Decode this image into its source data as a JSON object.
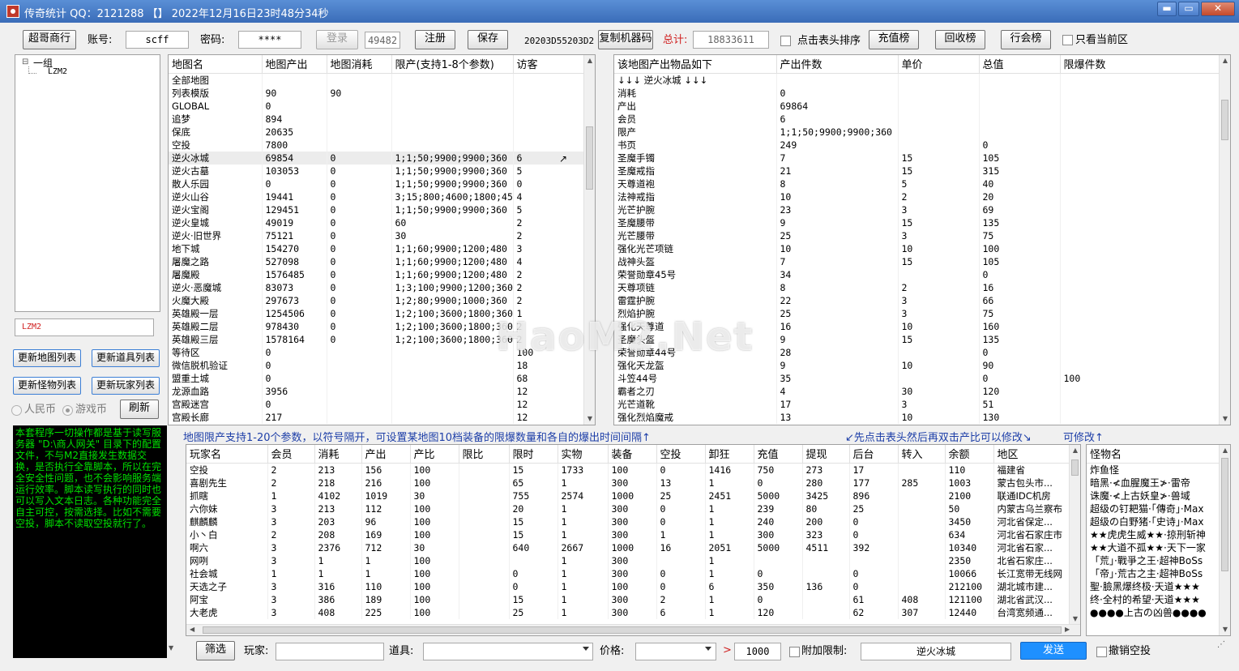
{
  "window": {
    "title": "传奇统计 QQ：2121288 【】 2022年12月16日23时48分34秒",
    "min": "▬",
    "max": "▭",
    "close": "✕"
  },
  "toolbar": {
    "shop_btn": "超哥商行",
    "account_label": "账号:",
    "account_value": "scff",
    "password_label": "密码:",
    "password_value": "****",
    "login_btn": "登录",
    "login_code": "49482",
    "register_btn": "注册",
    "save_btn": "保存",
    "machine_code": "20203D55203D2",
    "copy_machine_btn": "复制机器码",
    "total_label": "总计:",
    "total_value": "18833611",
    "sort_label": "点击表头排序",
    "recharge_btn": "充值榜",
    "recycle_btn": "回收榜",
    "guild_btn": "行会榜",
    "current_area_label": "只看当前区"
  },
  "tree": {
    "group": "一组",
    "child": "LZM2",
    "expander": "⊟"
  },
  "left_controls": {
    "selected_value": "LZM2",
    "update_map_btn": "更新地图列表",
    "update_item_btn": "更新道具列表",
    "update_monster_btn": "更新怪物列表",
    "update_player_btn": "更新玩家列表",
    "radio_rmb": "人民币",
    "radio_game": "游戏币",
    "refresh_btn": "刷新",
    "console_text": "本套程序一切操作都是基于读写服务器 \"D:\\商人网关\" 目录下的配置文件，不与M2直接发生数据交换，是否执行全靠脚本，所以在完全安全性问题，也不会影响服务端运行效率。脚本读写执行的同时也可以写入文本日志。各种功能完全自主可控，按需选择。比如不需要空投，脚本不读取空投就行了。"
  },
  "map_table": {
    "headers": [
      "地图名",
      "地图产出",
      "地图消耗",
      "限产(支持1-8个参数)",
      "访客"
    ],
    "rows": [
      [
        "全部地图",
        "",
        "",
        "",
        ""
      ],
      [
        "列表模版",
        "90",
        "90",
        "",
        ""
      ],
      [
        "GLOBAL",
        "0",
        "",
        "",
        ""
      ],
      [
        "追梦",
        "894",
        "",
        "",
        ""
      ],
      [
        "保底",
        "20635",
        "",
        "",
        ""
      ],
      [
        "空投",
        "7800",
        "",
        "",
        ""
      ],
      [
        "逆火冰城",
        "69854",
        "0",
        "1;1;50;9900;9900;360",
        "6"
      ],
      [
        "逆火古墓",
        "103053",
        "0",
        "1;1;50;9900;9900;360",
        "5"
      ],
      [
        "散人乐园",
        "0",
        "0",
        "1;1;50;9900;9900;360",
        "0"
      ],
      [
        "逆火山谷",
        "19441",
        "0",
        "3;15;800;4600;1800;45",
        "4"
      ],
      [
        "逆火宝阁",
        "129451",
        "0",
        "1;1;50;9900;9900;360",
        "5"
      ],
      [
        "逆火皇城",
        "49019",
        "0",
        "60",
        "2"
      ],
      [
        "逆火·旧世界",
        "75121",
        "0",
        "30",
        "2"
      ],
      [
        "地下城",
        "154270",
        "0",
        "1;1;60;9900;1200;480",
        "3"
      ],
      [
        "屠魔之路",
        "527098",
        "0",
        "1;1;60;9900;1200;480",
        "4"
      ],
      [
        "屠魔殿",
        "1576485",
        "0",
        "1;1;60;9900;1200;480",
        "2"
      ],
      [
        "逆火·恶魔城",
        "83073",
        "0",
        "1;3;100;9900;1200;360",
        "2"
      ],
      [
        "火魔大殿",
        "297673",
        "0",
        "1;2;80;9900;1000;360",
        "2"
      ],
      [
        "英雄殿一层",
        "1254506",
        "0",
        "1;2;100;3600;1800;360",
        "1"
      ],
      [
        "英雄殿二层",
        "978430",
        "0",
        "1;2;100;3600;1800;360",
        "2"
      ],
      [
        "英雄殿三层",
        "1578164",
        "0",
        "1;2;100;3600;1800;360",
        "2"
      ],
      [
        "等待区",
        "0",
        "",
        "",
        "100"
      ],
      [
        "微信脱机验证",
        "0",
        "",
        "",
        "18"
      ],
      [
        "盟重土城",
        "0",
        "",
        "",
        "68"
      ],
      [
        "龙源血路",
        "3956",
        "",
        "",
        "12"
      ],
      [
        "宫殿迷宫",
        "0",
        "",
        "",
        "12"
      ],
      [
        "宫殿长廊",
        "217",
        "",
        "",
        "12"
      ]
    ],
    "cursor": "↗"
  },
  "item_table": {
    "headers": [
      "该地图产出物品如下",
      "产出件数",
      "单价",
      "总值",
      "限爆件数"
    ],
    "rows": [
      [
        "↓↓↓ 逆火冰城 ↓↓↓",
        "",
        "",
        "",
        ""
      ],
      [
        "消耗",
        "0",
        "",
        "",
        ""
      ],
      [
        "产出",
        "69864",
        "",
        "",
        ""
      ],
      [
        "会员",
        "6",
        "",
        "",
        ""
      ],
      [
        "限产",
        "1;1;50;9900;9900;360",
        "",
        "",
        ""
      ],
      [
        "书页",
        "249",
        "",
        "0",
        ""
      ],
      [
        "圣魔手镯",
        "7",
        "15",
        "105",
        ""
      ],
      [
        "圣魔戒指",
        "21",
        "15",
        "315",
        ""
      ],
      [
        "天尊道袍",
        "8",
        "5",
        "40",
        ""
      ],
      [
        "法神戒指",
        "10",
        "2",
        "20",
        ""
      ],
      [
        "光芒护腕",
        "23",
        "3",
        "69",
        ""
      ],
      [
        "圣魔腰带",
        "9",
        "15",
        "135",
        ""
      ],
      [
        "光芒腰带",
        "25",
        "3",
        "75",
        ""
      ],
      [
        "强化光芒项链",
        "10",
        "10",
        "100",
        ""
      ],
      [
        "战神头盔",
        "7",
        "15",
        "105",
        ""
      ],
      [
        "荣誉勋章45号",
        "34",
        "",
        "0",
        ""
      ],
      [
        "天尊项链",
        "8",
        "2",
        "16",
        ""
      ],
      [
        "雷霆护腕",
        "22",
        "3",
        "66",
        ""
      ],
      [
        "烈焰护腕",
        "25",
        "3",
        "75",
        ""
      ],
      [
        "强化天尊道",
        "16",
        "10",
        "160",
        ""
      ],
      [
        "圣魔头盔",
        "9",
        "15",
        "135",
        ""
      ],
      [
        "荣誉勋章44号",
        "28",
        "",
        "0",
        ""
      ],
      [
        "强化天龙盔",
        "9",
        "10",
        "90",
        ""
      ],
      [
        "斗笠44号",
        "35",
        "",
        "0",
        "100"
      ],
      [
        "霸者之刃",
        "4",
        "30",
        "120",
        ""
      ],
      [
        "光芒道靴",
        "17",
        "3",
        "51",
        ""
      ],
      [
        "强化烈焰魔戒",
        "13",
        "10",
        "130",
        ""
      ]
    ]
  },
  "hints": {
    "param_hint": "地图限产支持1-20个参数，以符号隔开，可设置某地图10档装备的限爆数量和各自的爆出时间间隔↑",
    "edit_hint": "↙先点击表头然后再双击产比可以修改↘",
    "editable_hint": "可修改↑"
  },
  "watermark": "HaoM2.Net",
  "player_table": {
    "headers": [
      "玩家名",
      "会员",
      "消耗",
      "产出",
      "产比",
      "限比",
      "限时",
      "实物",
      "装备",
      "空投",
      "卸狂",
      "充值",
      "提现",
      "后台",
      "转入",
      "余额",
      "地区"
    ],
    "rows": [
      [
        "空投",
        "2",
        "213",
        "156",
        "100",
        "",
        "15",
        "1733",
        "100",
        "0",
        "1416",
        "750",
        "273",
        "17",
        "",
        "110",
        "福建省"
      ],
      [
        "喜剧先生",
        "2",
        "218",
        "216",
        "100",
        "",
        "65",
        "1",
        "300",
        "13",
        "1",
        "0",
        "280",
        "177",
        "285",
        "1003",
        "蒙古包头市..."
      ],
      [
        "抓瞎",
        "1",
        "4102",
        "1019",
        "30",
        "",
        "755",
        "2574",
        "1000",
        "25",
        "2451",
        "5000",
        "3425",
        "896",
        "",
        "2100",
        "联通IDC机房"
      ],
      [
        "六你妹",
        "3",
        "213",
        "112",
        "100",
        "",
        "20",
        "1",
        "300",
        "0",
        "1",
        "239",
        "80",
        "25",
        "",
        "50",
        "内蒙古乌兰察布"
      ],
      [
        "麒麟麟",
        "3",
        "203",
        "96",
        "100",
        "",
        "15",
        "1",
        "300",
        "0",
        "1",
        "240",
        "200",
        "0",
        "",
        "3450",
        "河北省保定..."
      ],
      [
        "小丶白",
        "2",
        "208",
        "169",
        "100",
        "",
        "15",
        "1",
        "300",
        "1",
        "1",
        "300",
        "323",
        "0",
        "",
        "634",
        "河北省石家庄市"
      ],
      [
        "啊六",
        "3",
        "2376",
        "712",
        "30",
        "",
        "640",
        "2667",
        "1000",
        "16",
        "2051",
        "5000",
        "4511",
        "392",
        "",
        "10340",
        "河北省石家..."
      ],
      [
        "网咧",
        "3",
        "1",
        "1",
        "100",
        "",
        "",
        "1",
        "300",
        "",
        "1",
        "",
        "",
        "",
        "",
        "2350",
        "北省石家庄..."
      ],
      [
        "社会城",
        "1",
        "1",
        "1",
        "100",
        "",
        "0",
        "1",
        "300",
        "0",
        "1",
        "0",
        "",
        "0",
        "",
        "10066",
        "长江宽带无线网"
      ],
      [
        "天选之子",
        "3",
        "316",
        "110",
        "100",
        "",
        "0",
        "1",
        "100",
        "0",
        "6",
        "350",
        "136",
        "0",
        "",
        "212100",
        "湖北城市建..."
      ],
      [
        "阿宝",
        "3",
        "386",
        "189",
        "100",
        "",
        "15",
        "1",
        "300",
        "2",
        "1",
        "0",
        "",
        "61",
        "408",
        "121100",
        "湖北省武汉..."
      ],
      [
        "大老虎",
        "3",
        "408",
        "225",
        "100",
        "",
        "25",
        "1",
        "300",
        "6",
        "1",
        "120",
        "",
        "62",
        "307",
        "12440",
        "台湾宽频通..."
      ]
    ]
  },
  "monster_table": {
    "header": "怪物名",
    "rows": [
      "炸鱼怪",
      "暗黑·≮血腥魔王≯·雷帝",
      "诛魔·≮上古妖皇≯·兽域",
      "超级の钉耙猫·「傳奇」·Max",
      "超级の白野猪·「史诗」·Max",
      "★★虎虎生威★★·掠刑斩神",
      "★★大道不孤★★·天下一家",
      "「荒」·戰爭之王·超神BoSs",
      "「帝」·荒古之主·超神BoSs",
      "聖·臉黑爆终极·天道★★★",
      "终·全村的希望·天道★★★",
      "●●●●上古の凶兽●●●●"
    ]
  },
  "bottom_bar": {
    "filter_btn": "筛选",
    "player_label": "玩家:",
    "player_value": "",
    "item_label": "道具:",
    "item_value": "",
    "price_label": "价格:",
    "price_value": "",
    "gt": ">",
    "amount": "1000",
    "extra_limit_label": "附加限制:",
    "map_value": "逆火冰城",
    "send_btn": "发送",
    "cancel_airdrop_label": "撤销空投"
  }
}
